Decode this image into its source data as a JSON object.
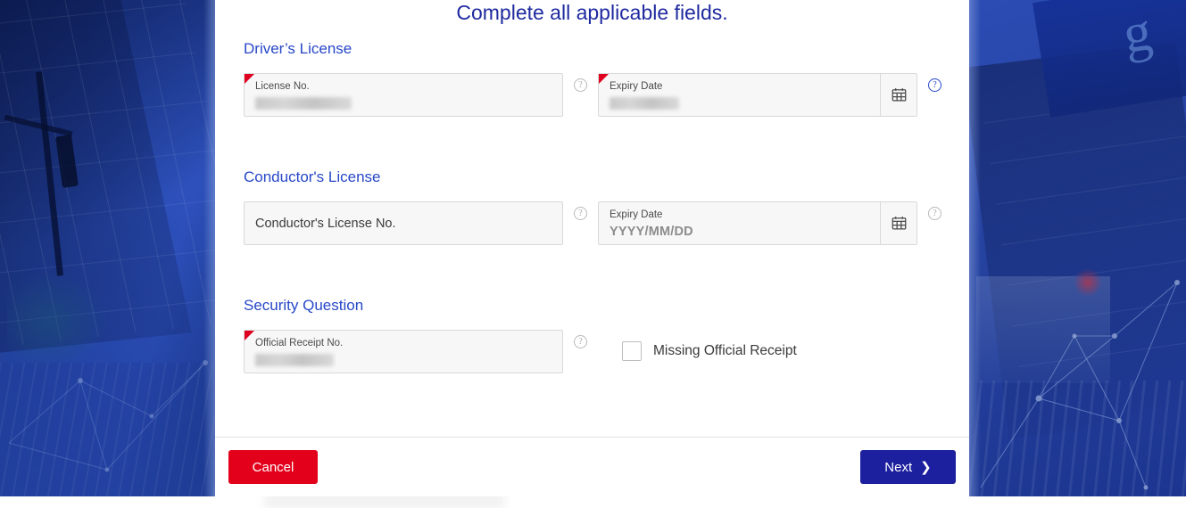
{
  "page": {
    "title": "Complete all applicable fields."
  },
  "sections": [
    {
      "id": "drivers-license",
      "title": "Driver’s License",
      "fields": [
        {
          "name": "license-no",
          "label": "License No.",
          "value": "████ ████ ████",
          "redacted": true,
          "required": true,
          "help_icon": "question-mark-icon",
          "help_active": false
        },
        {
          "name": "drivers-license-expiry-date",
          "label": "Expiry Date",
          "value": "████████",
          "redacted": true,
          "required": true,
          "picker_icon": "calendar-icon",
          "help_icon": "question-mark-icon",
          "help_active": true
        }
      ]
    },
    {
      "id": "conductors-license",
      "title": "Conductor's License",
      "fields": [
        {
          "name": "conductors-license-no",
          "placeholder": "Conductor's License No.",
          "value": "",
          "redacted": false,
          "required": false,
          "help_icon": "question-mark-icon",
          "help_active": false
        },
        {
          "name": "conductors-license-expiry-date",
          "label": "Expiry Date",
          "value": "YYYY/MM/DD",
          "is_placeholder": true,
          "redacted": false,
          "required": false,
          "picker_icon": "calendar-icon",
          "help_icon": "question-mark-icon",
          "help_active": false
        }
      ]
    },
    {
      "id": "security-question",
      "title": "Security Question",
      "fields": [
        {
          "name": "official-receipt-no",
          "label": "Official Receipt No.",
          "value": "█████████",
          "redacted": true,
          "required": true,
          "help_icon": "question-mark-icon",
          "help_active": false
        }
      ],
      "checkbox": {
        "name": "missing-official-receipt",
        "label": "Missing Official Receipt",
        "checked": false
      }
    }
  ],
  "footer": {
    "cancel_label": "Cancel",
    "next_label": "Next",
    "next_icon": "chevron-right-icon"
  },
  "colors": {
    "title_blue": "#1f2aa0",
    "section_blue": "#2747c7",
    "required_red": "#e00020",
    "cancel_red": "#e2001a",
    "next_blue": "#1c1f9e",
    "field_bg": "#f7f7f7",
    "field_border": "#d9d9d9",
    "background_blue": "#2547b5"
  }
}
